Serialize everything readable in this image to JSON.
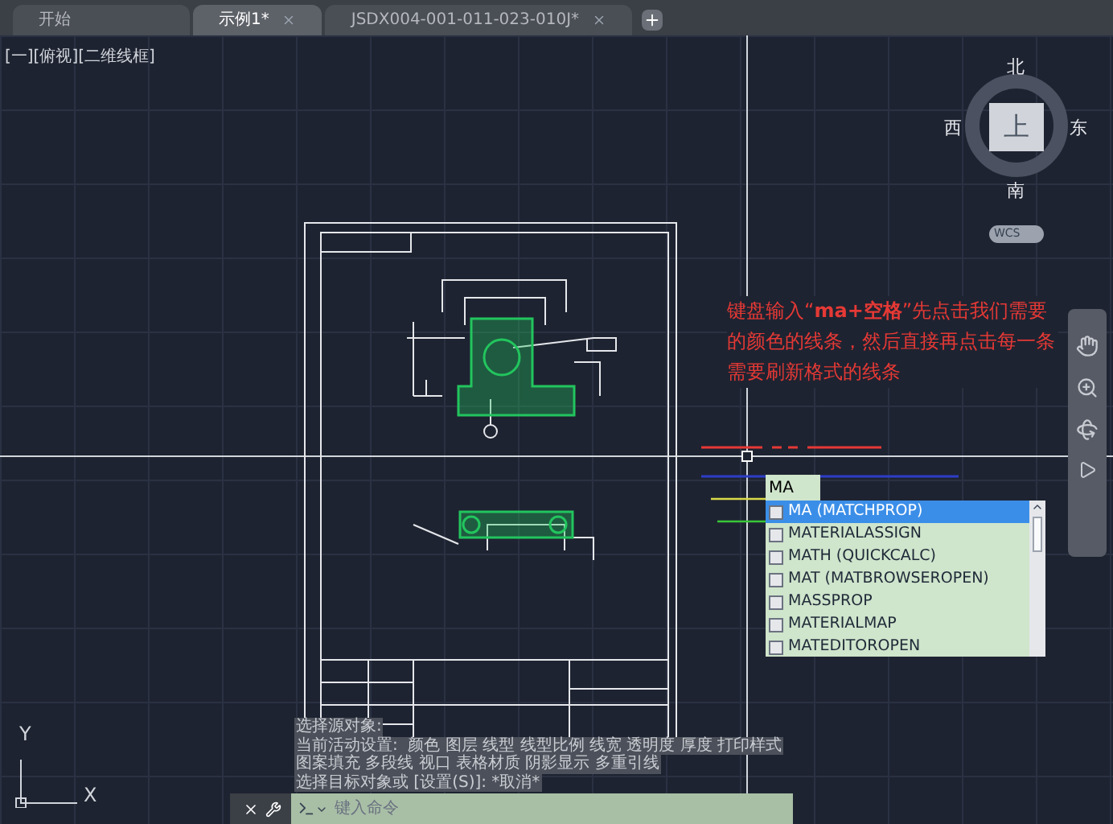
{
  "tabs": [
    {
      "label": "开始",
      "selected": false,
      "closable": false
    },
    {
      "label": "示例1*",
      "selected": true,
      "closable": true
    },
    {
      "label": "JSDX004-001-011-023-010J*",
      "selected": false,
      "closable": true
    }
  ],
  "viewport_label": "[一][俯视][二维线框]",
  "viewcube": {
    "north": "北",
    "south": "南",
    "west": "西",
    "east": "东",
    "top": "上",
    "wcs": "WCS"
  },
  "annotation": "键盘输入“**ma+空格**”先点击我们需要的颜色的线条，然后直接再点击每一条需要刷新格式的线条",
  "command_input": {
    "value": "MA"
  },
  "autocomplete": [
    {
      "label": "MA (MATCHPROP)",
      "selected": true
    },
    {
      "label": "MATERIALASSIGN",
      "selected": false
    },
    {
      "label": "MATH (QUICKCALC)",
      "selected": false
    },
    {
      "label": "MAT (MATBROWSEROPEN)",
      "selected": false
    },
    {
      "label": "MASSPROP",
      "selected": false
    },
    {
      "label": "MATERIALMAP",
      "selected": false
    },
    {
      "label": "MATEDITOROPEN",
      "selected": false
    }
  ],
  "command_history": [
    "选择源对象:",
    "当前活动设置:  颜色 图层 线型 线型比例 线宽 透明度 厚度 打印样式",
    "图案填充 多段线 视口 表格材质 阴影显示 多重引线",
    "选择目标对象或 [设置(S)]: *取消*"
  ],
  "command_line": {
    "placeholder": "键入命令"
  },
  "ucs": {
    "x": "X",
    "y": "Y"
  }
}
